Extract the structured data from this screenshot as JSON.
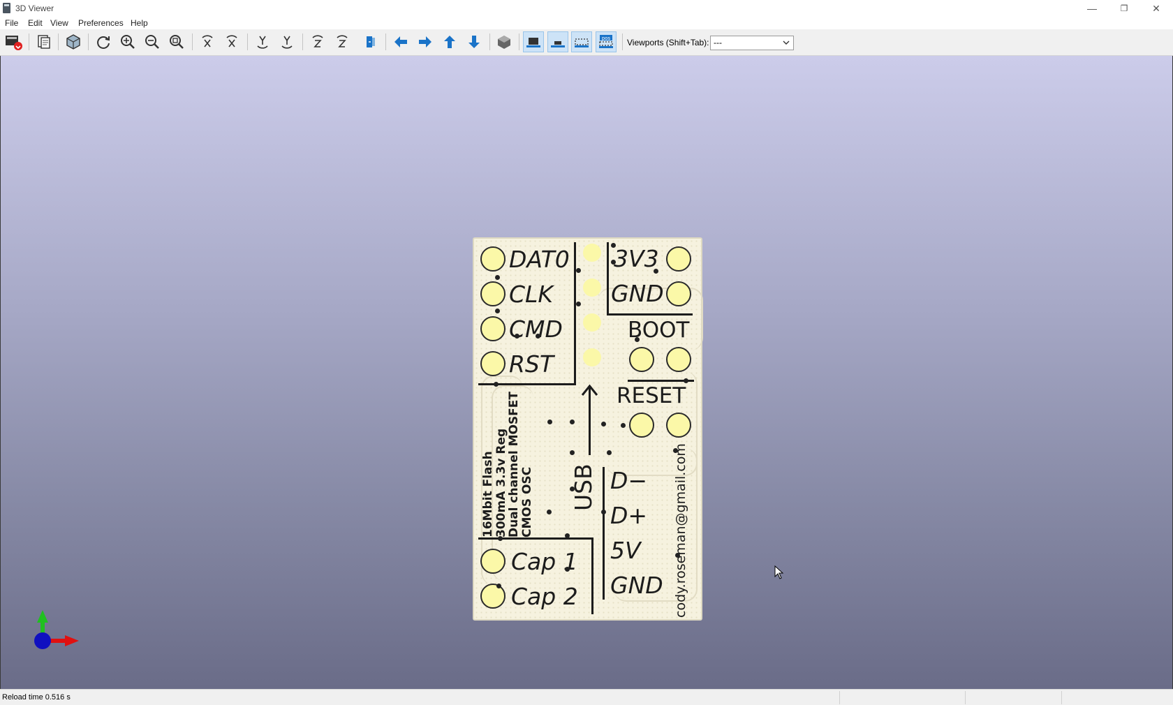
{
  "window": {
    "title": "3D Viewer",
    "minimize_glyph": "—",
    "restore_glyph": "❐",
    "close_glyph": "✕"
  },
  "menu": {
    "file": "File",
    "edit": "Edit",
    "view": "View",
    "preferences": "Preferences",
    "help": "Help"
  },
  "toolbar": {
    "buttons": [
      "reload-board-icon",
      "copy-image-icon",
      "raytracing-icon",
      "redraw-icon",
      "zoom-in-icon",
      "zoom-out-icon",
      "zoom-fit-icon",
      "rotate-x-cw-icon",
      "rotate-x-ccw-icon",
      "rotate-y-cw-icon",
      "rotate-y-ccw-icon",
      "rotate-z-cw-icon",
      "rotate-z-ccw-icon",
      "flip-board-icon",
      "move-left-icon",
      "move-right-icon",
      "move-up-icon",
      "move-down-icon",
      "ortho-icon",
      "show-tht-icon",
      "show-smd-icon",
      "show-virtual-icon",
      "show-not-in-posfile-icon"
    ],
    "viewports_label": "Viewports (Shift+Tab):",
    "viewports_value": "---",
    "accent": "#1a73c8"
  },
  "pcb": {
    "left_labels": [
      "DAT0",
      "CLK",
      "CMD",
      "RST"
    ],
    "right_labels": [
      "3V3",
      "GND"
    ],
    "boot_label": "BOOT",
    "reset_label": "RESET",
    "usb_label": "USB",
    "usb_pins": [
      "D−",
      "D+",
      "5V",
      "GND"
    ],
    "cap_labels": [
      "Cap 1",
      "Cap 2"
    ],
    "vertical_text_lines": [
      "16Mbit Flash",
      "300mA 3.3v Reg",
      "Dual channel MOSFET",
      "CMOS OSC"
    ],
    "email": "cody.roseman@gmail.com",
    "pad_color": "#fbf8a8",
    "board_color": "#f6f2df",
    "silk_color": "#1c1c1c"
  },
  "axes": {
    "x_color": "#e01010",
    "y_color": "#20c020",
    "z_color": "#1010c0"
  },
  "status": {
    "text": "Reload time 0.516 s"
  }
}
